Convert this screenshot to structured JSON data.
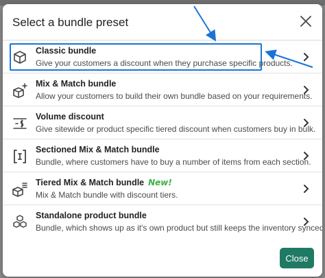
{
  "modal": {
    "title": "Select a bundle preset",
    "close_label": "Close"
  },
  "presets": [
    {
      "title": "Classic bundle",
      "description": "Give your customers a discount when they purchase specific products.",
      "icon": "box-icon",
      "badge": ""
    },
    {
      "title": "Mix & Match bundle",
      "description": "Allow your customers to build their own bundle based on your requirements.",
      "icon": "box-plus-icon",
      "badge": ""
    },
    {
      "title": "Volume discount",
      "description": "Give sitewide or product specific tiered discount when customers buy in bulk.",
      "icon": "volume-discount-icon",
      "badge": ""
    },
    {
      "title": "Sectioned Mix & Match bundle",
      "description": "Bundle, where customers have to buy a number of items from each section.",
      "icon": "sectioned-bracket-icon",
      "badge": ""
    },
    {
      "title": "Tiered Mix & Match bundle",
      "description": "Mix & Match bundle with discount tiers.",
      "icon": "tiered-box-icon",
      "badge": "New!"
    },
    {
      "title": "Standalone product bundle",
      "description": "Bundle, which shows up as it's own product but still keeps the inventory synced.",
      "icon": "stacked-boxes-icon",
      "badge": ""
    }
  ],
  "colors": {
    "highlight": "#1a74d8",
    "primary_button": "#1f7a63",
    "badge": "#3cb043"
  }
}
